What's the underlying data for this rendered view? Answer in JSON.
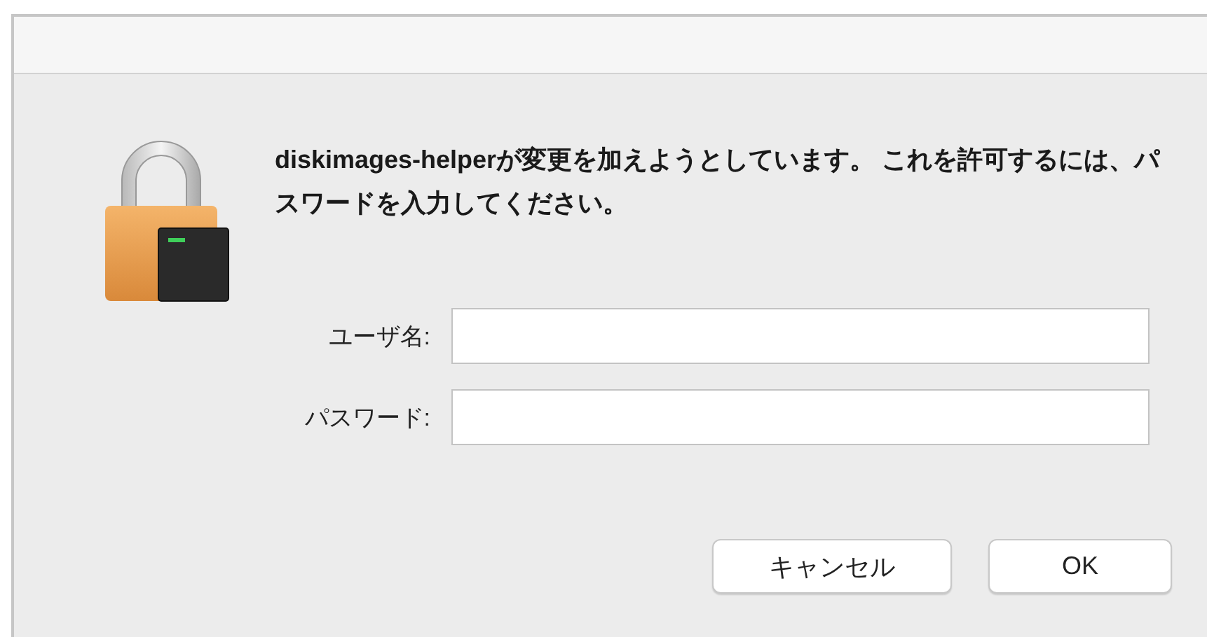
{
  "dialog": {
    "message": "diskimages-helperが変更を加えようとしています。 これを許可するには、パスワードを入力してください。"
  },
  "fields": [
    {
      "label": "ユーザ名:"
    },
    {
      "label": "パスワード:"
    }
  ],
  "buttons": [
    {
      "label": "キャンセル"
    },
    {
      "label": "OK"
    }
  ]
}
